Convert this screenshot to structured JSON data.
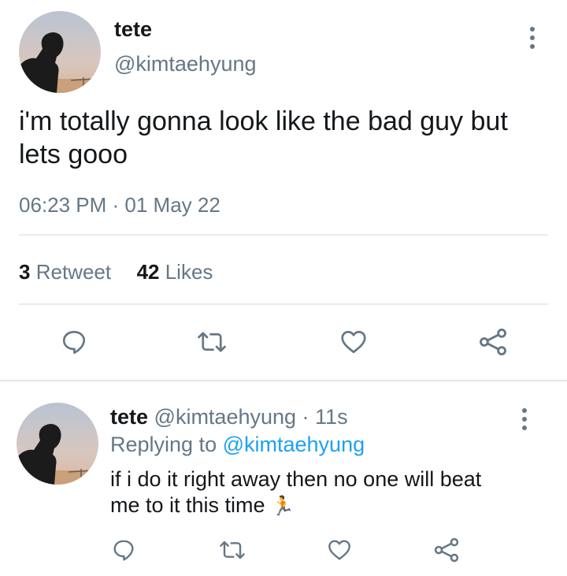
{
  "main_tweet": {
    "display_name": "tete",
    "handle": "@kimtaehyung",
    "text_line1": "i'm totally gonna look like the bad guy but",
    "text_line2": "lets gooo",
    "timestamp": "06:23 PM · 01 May 22",
    "retweet_count": "3",
    "retweet_label": "Retweet",
    "likes_count": "42",
    "likes_label": "Likes"
  },
  "reply_tweet": {
    "display_name": "tete",
    "handle": "@kimtaehyung",
    "time_ago": "· 11s",
    "replying_prefix": "Replying to",
    "replying_handle": "@kimtaehyung",
    "text_line1": "if i do it right away then no one will beat",
    "text_line2": "me to it this time",
    "emoji": "🏃"
  },
  "icons": {
    "reply": "reply-icon",
    "retweet": "retweet-icon",
    "like": "heart-icon",
    "share": "share-icon",
    "more": "more-vertical-icon"
  },
  "colors": {
    "text": "#14171a",
    "secondary": "#657786",
    "link": "#1da1f2",
    "divider": "#e6ecf0"
  }
}
